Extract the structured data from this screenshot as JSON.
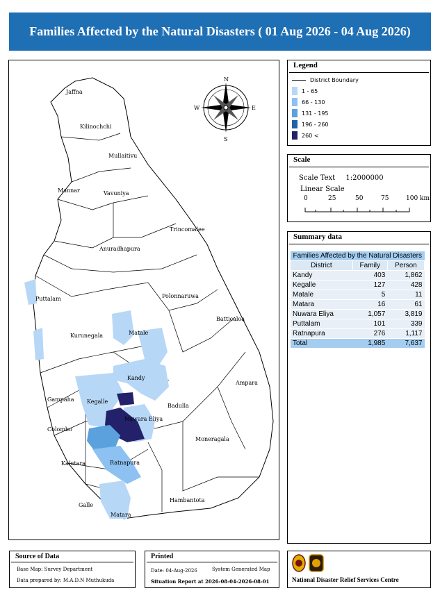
{
  "title": "Families Affected by the Natural Disasters ( 01 Aug 2026 - 04 Aug 2026)",
  "legend": {
    "heading": "Legend",
    "boundary_label": "District Boundary",
    "classes": [
      {
        "label": "1 - 65",
        "color": "#b7d7f7"
      },
      {
        "label": "66 - 130",
        "color": "#8cc1f2"
      },
      {
        "label": "131 - 195",
        "color": "#5aa1dd"
      },
      {
        "label": "196 - 260",
        "color": "#1f62a8"
      },
      {
        "label": "260 <",
        "color": "#232169"
      }
    ]
  },
  "scale": {
    "heading": "Scale",
    "scale_text_label": "Scale Text",
    "scale_text_value": "1:2000000",
    "linear_label": "Linear Scale",
    "ticks": [
      "0",
      "25",
      "50",
      "75",
      "100 km"
    ]
  },
  "summary": {
    "heading": "Summary data",
    "caption": "Families Affected by the Natural Disasters",
    "columns": [
      "District",
      "Family",
      "Person"
    ],
    "rows": [
      [
        "Kandy",
        "403",
        "1,862"
      ],
      [
        "Kegalle",
        "127",
        "428"
      ],
      [
        "Matale",
        "5",
        "11"
      ],
      [
        "Matara",
        "16",
        "61"
      ],
      [
        "Nuwara Eliya",
        "1,057",
        "3,819"
      ],
      [
        "Puttalam",
        "101",
        "339"
      ],
      [
        "Ratnapura",
        "276",
        "1,117"
      ]
    ],
    "total": [
      "Total",
      "1,985",
      "7,637"
    ]
  },
  "map": {
    "compass": {
      "n": "N",
      "s": "S",
      "e": "E",
      "w": "W"
    },
    "districts": [
      "Jaffna",
      "Kilinochchi",
      "Mullaitivu",
      "Mannar",
      "Vavuniya",
      "Trincomalee",
      "Anuradhapura",
      "Puttalam",
      "Polonnaruwa",
      "Batticaloa",
      "Kurunegala",
      "Matale",
      "Kandy",
      "Ampara",
      "Gampaha",
      "Kegalle",
      "Nuwara Eliya",
      "Badulla",
      "Colombo",
      "Moneragala",
      "Kalutara",
      "Ratnapura",
      "Hambantota",
      "Galle",
      "Matara"
    ]
  },
  "source": {
    "heading": "Source of Data",
    "base_map": "Base Map: Survey Department",
    "prepared": "Data prepared by: M.A.D.N Muthukuda"
  },
  "printed": {
    "heading": "Printed",
    "date": "Date: 04-Aug-2026",
    "generated": "System Generated Map",
    "report": "Situation Report at 2026-08-04-2026-08-01"
  },
  "org": {
    "name": "National Disaster Relief Services Centre"
  }
}
